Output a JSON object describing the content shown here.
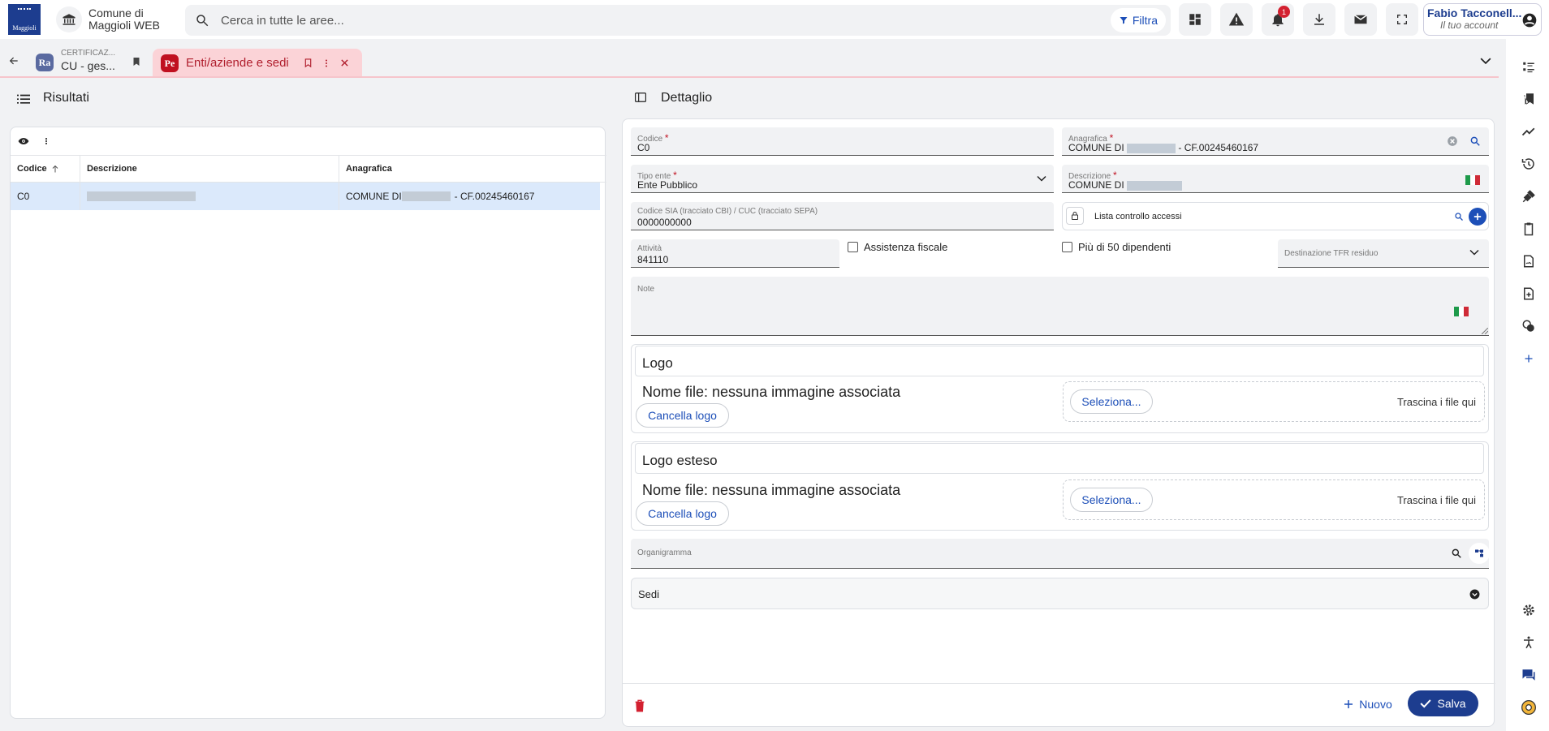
{
  "header": {
    "logo_text": "Maggioli",
    "app_name_line1": "Comune di",
    "app_name_line2": "Maggioli WEB",
    "search_placeholder": "Cerca in tutte le aree...",
    "filter_label": "Filtra",
    "notifications_count": "1",
    "user_name": "Fabio Tacconell...",
    "user_sub": "Il tuo account"
  },
  "tabs": [
    {
      "initials": "Ra",
      "caption": "CERTIFICAZ...",
      "label": "CU - ges..."
    },
    {
      "initials": "Pe",
      "label": "Enti/aziende e sedi"
    }
  ],
  "left": {
    "title": "Risultati",
    "columns": [
      "Codice",
      "Descrizione",
      "Anagrafica"
    ],
    "row": {
      "codice": "C0",
      "anagrafica_prefix": "COMUNE DI",
      "anagrafica_suffix": "- CF.00245460167"
    }
  },
  "detail": {
    "title": "Dettaglio",
    "codice": {
      "label": "Codice",
      "value": "C0"
    },
    "anagrafica": {
      "label": "Anagrafica",
      "prefix": "COMUNE DI",
      "suffix": "- CF.00245460167"
    },
    "tipo_ente": {
      "label": "Tipo ente",
      "value": "Ente Pubblico"
    },
    "descrizione": {
      "label": "Descrizione",
      "prefix": "COMUNE DI"
    },
    "codice_sia": {
      "label": "Codice SIA (tracciato CBI) / CUC (tracciato SEPA)",
      "value": "0000000000"
    },
    "lista": {
      "label": "Lista controllo accessi"
    },
    "attivita": {
      "label": "Attività",
      "value": "841110"
    },
    "assistenza": "Assistenza fiscale",
    "dipendenti": "Più di 50 dipendenti",
    "tfr": "Destinazione TFR residuo",
    "note": "Note",
    "logo": {
      "title": "Logo",
      "filename": "Nome file: nessuna immagine associata",
      "cancel": "Cancella logo",
      "select": "Seleziona...",
      "drop": "Trascina i file qui"
    },
    "logo_esteso": {
      "title": "Logo esteso",
      "filename": "Nome file: nessuna immagine associata",
      "cancel": "Cancella logo",
      "select": "Seleziona...",
      "drop": "Trascina i file qui"
    },
    "organigramma": "Organigramma",
    "sedi": "Sedi",
    "nuovo": "Nuovo",
    "salva": "Salva"
  },
  "colors": {
    "brand": "#1d3d8f",
    "accent": "#1d4fb8",
    "tab_active_bg": "#fbd3d7",
    "tab_active_text": "#b01e2d",
    "danger": "#c01020"
  }
}
